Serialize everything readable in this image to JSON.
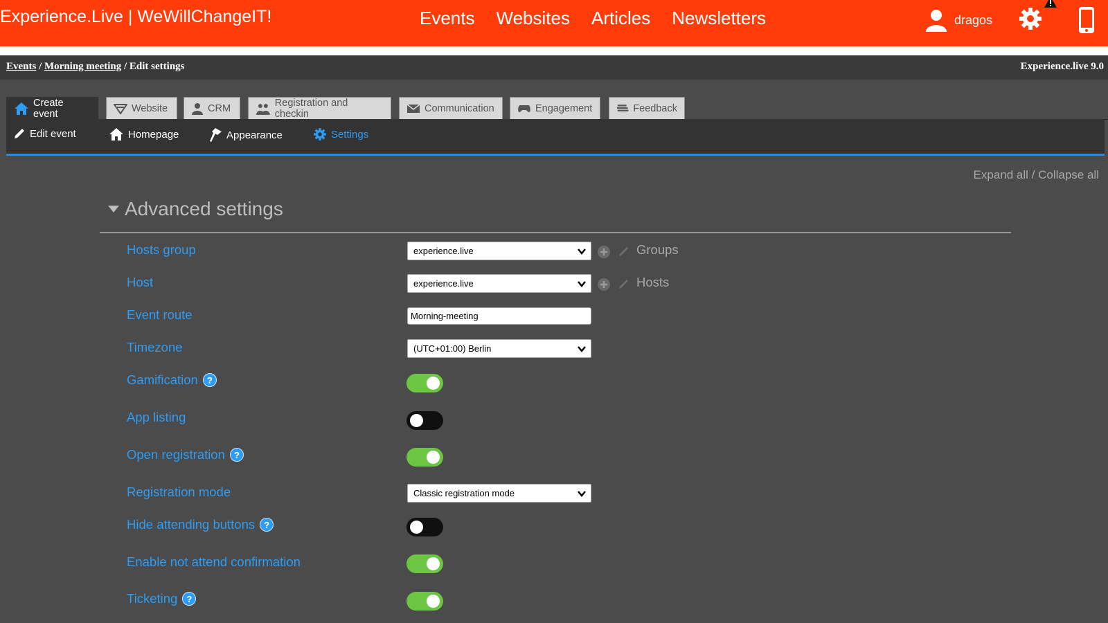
{
  "header": {
    "brand": "Experience.Live | WeWillChangeIT!",
    "nav": [
      "Events",
      "Websites",
      "Articles",
      "Newsletters"
    ],
    "username": "dragos"
  },
  "breadcrumb": {
    "items": [
      "Events",
      "Morning meeting"
    ],
    "current": "Edit settings",
    "separator": "/",
    "version": "Experience.live 9.0"
  },
  "tabs": [
    "Create event",
    "Website",
    "CRM",
    "Registration and checkin",
    "Communication",
    "Engagement",
    "Feedback"
  ],
  "subtabs": [
    "Edit event",
    "Homepage",
    "Appearance",
    "Settings"
  ],
  "expand_collapse": "Expand all / Collapse all",
  "section": {
    "title": "Advanced settings",
    "fields": {
      "hosts_group": {
        "label": "Hosts group",
        "value": "experience.live",
        "aside": "Groups"
      },
      "host": {
        "label": "Host",
        "value": "experience.live",
        "aside": "Hosts"
      },
      "event_route": {
        "label": "Event route",
        "value": "Morning-meeting"
      },
      "timezone": {
        "label": "Timezone",
        "value": "(UTC+01:00) Berlin"
      },
      "gamification": {
        "label": "Gamification",
        "on": true
      },
      "app_listing": {
        "label": "App listing",
        "on": false
      },
      "open_registration": {
        "label": "Open registration",
        "on": true
      },
      "registration_mode": {
        "label": "Registration mode",
        "value": "Classic registration mode"
      },
      "hide_attending_buttons": {
        "label": "Hide attending buttons",
        "on": false
      },
      "enable_not_attend_confirmation": {
        "label": "Enable not attend confirmation",
        "on": true
      },
      "ticketing": {
        "label": "Ticketing",
        "on": true
      }
    },
    "help_glyph": "?"
  },
  "colors": {
    "topbar": "#ff3c0a",
    "accent_blue": "#2e9cf2",
    "toggle_on": "#6cc644",
    "toggle_off": "#101010",
    "background": "#4b4b4b"
  }
}
